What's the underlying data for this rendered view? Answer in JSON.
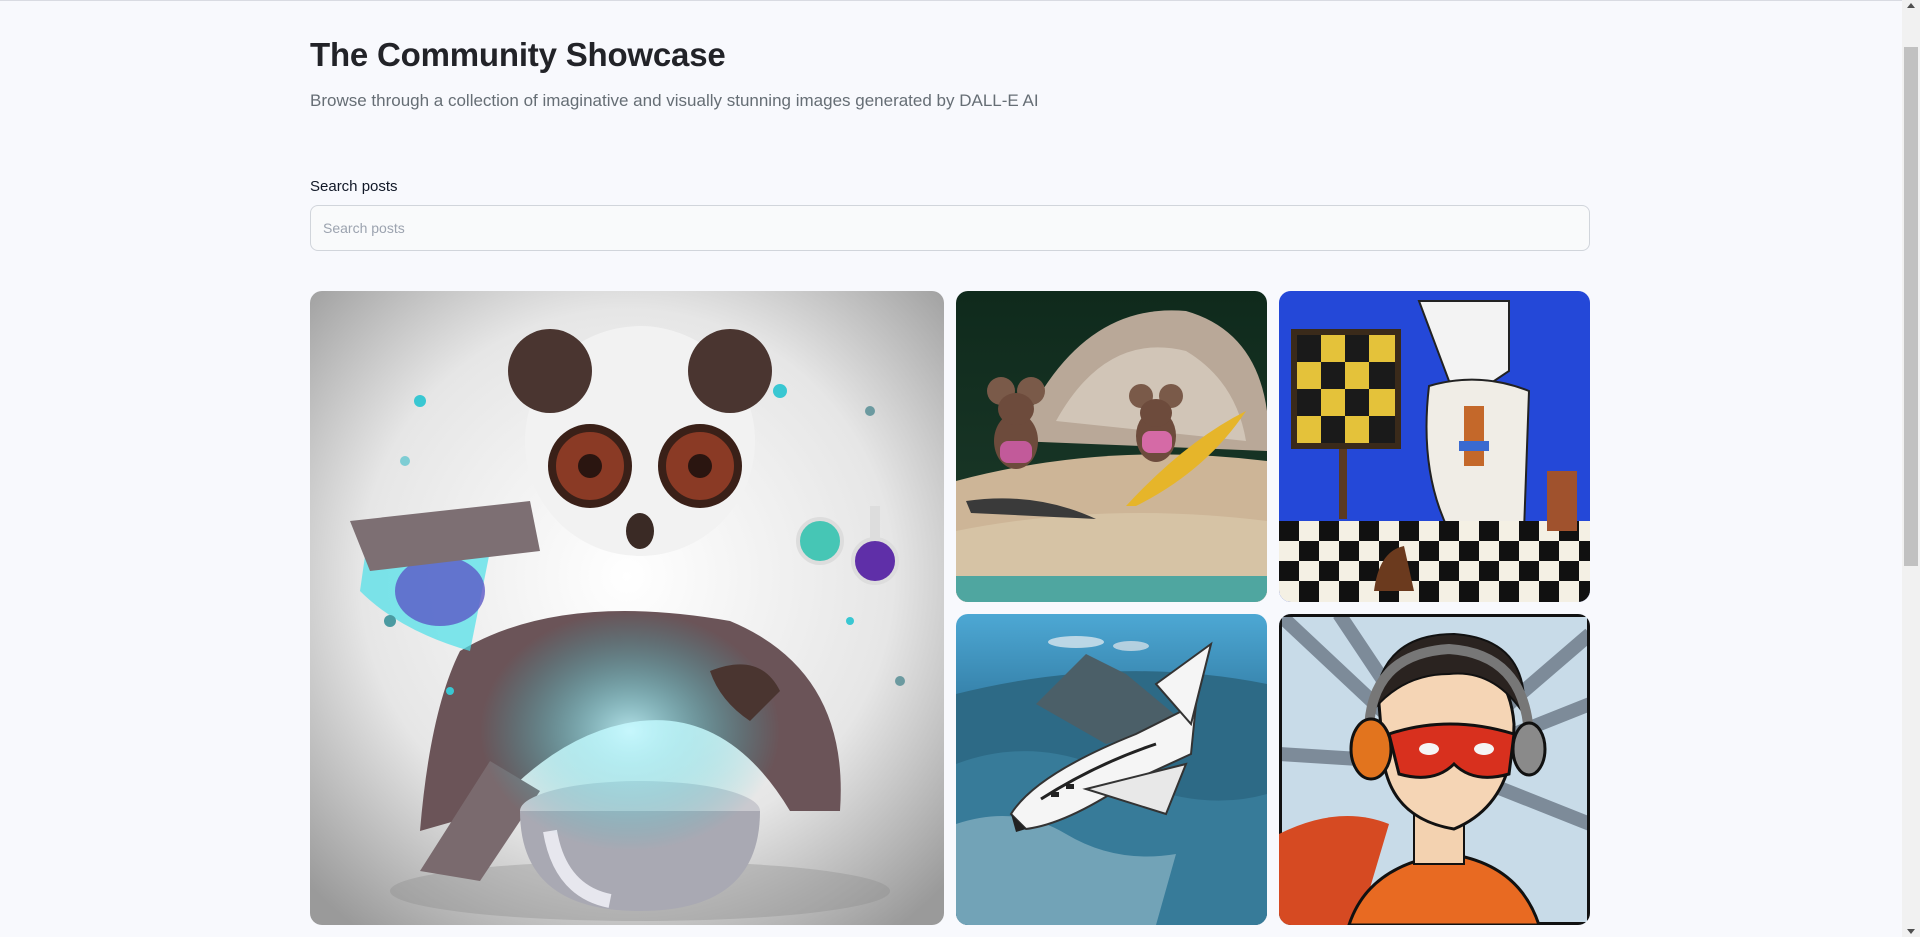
{
  "header": {
    "title": "The Community Showcase",
    "subtitle": "Browse through a collection of imaginative and visually stunning images generated by DALL-E AI"
  },
  "search": {
    "label": "Search posts",
    "placeholder": "Search posts",
    "value": ""
  },
  "gallery": {
    "cards": [
      {
        "id": "panda",
        "subject": "panda scientist pouring glowing potion"
      },
      {
        "id": "mice",
        "subject": "mice with surfboards on beach"
      },
      {
        "id": "chess",
        "subject": "painting of horse playing chess"
      },
      {
        "id": "shuttle",
        "subject": "space shuttle above earth"
      },
      {
        "id": "hero",
        "subject": "comic superhero with headphones"
      }
    ]
  },
  "colors": {
    "background": "#f8f9fd",
    "title": "#222328",
    "subtitle": "#666e75"
  }
}
